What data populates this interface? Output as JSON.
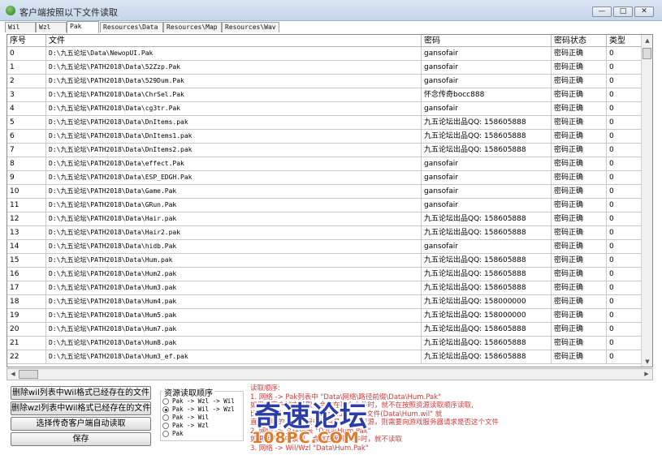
{
  "window": {
    "title": "客户端按照以下文件读取",
    "minimize_label": "—",
    "maximize_label": "□",
    "close_label": "✕",
    "icon": "app-icon"
  },
  "tabs": [
    {
      "label": "Wil"
    },
    {
      "label": "Wzl"
    },
    {
      "label": "Pak"
    },
    {
      "label": "Resources\\Data"
    },
    {
      "label": "Resources\\Map"
    },
    {
      "label": "Resources\\Wav"
    }
  ],
  "table": {
    "columns": [
      "序号",
      "文件",
      "密码",
      "密码状态",
      "类型"
    ],
    "rows": [
      [
        "0",
        "D:\\九五论坛\\Data\\NewopUI.Pak",
        "gansofair",
        "密码正确",
        "0"
      ],
      [
        "1",
        "D:\\九五论坛\\PATH2018\\Data\\52Zzp.Pak",
        "gansofair",
        "密码正确",
        "0"
      ],
      [
        "2",
        "D:\\九五论坛\\PATH2018\\Data\\529Dum.Pak",
        "gansofair",
        "密码正确",
        "0"
      ],
      [
        "3",
        "D:\\九五论坛\\PATH2018\\Data\\ChrSel.Pak",
        "怀念传奇bocc888",
        "密码正确",
        "0"
      ],
      [
        "4",
        "D:\\九五论坛\\PATH2018\\Data\\cg3tr.Pak",
        "gansofair",
        "密码正确",
        "0"
      ],
      [
        "5",
        "D:\\九五论坛\\PATH2018\\Data\\DnItems.pak",
        "九五论坛出品QQ: 158605888",
        "密码正确",
        "0"
      ],
      [
        "6",
        "D:\\九五论坛\\PATH2018\\Data\\DnItems1.pak",
        "九五论坛出品QQ: 158605888",
        "密码正确",
        "0"
      ],
      [
        "7",
        "D:\\九五论坛\\PATH2018\\Data\\DnItems2.pak",
        "九五论坛出品QQ: 158605888",
        "密码正确",
        "0"
      ],
      [
        "8",
        "D:\\九五论坛\\PATH2018\\Data\\effect.Pak",
        "gansofair",
        "密码正确",
        "0"
      ],
      [
        "9",
        "D:\\九五论坛\\PATH2018\\Data\\ESP_EDGH.Pak",
        "gansofair",
        "密码正确",
        "0"
      ],
      [
        "10",
        "D:\\九五论坛\\PATH2018\\Data\\Game.Pak",
        "gansofair",
        "密码正确",
        "0"
      ],
      [
        "11",
        "D:\\九五论坛\\PATH2018\\Data\\GRun.Pak",
        "gansofair",
        "密码正确",
        "0"
      ],
      [
        "12",
        "D:\\九五论坛\\PATH2018\\Data\\Hair.pak",
        "九五论坛出品QQ: 158605888",
        "密码正确",
        "0"
      ],
      [
        "13",
        "D:\\九五论坛\\PATH2018\\Data\\Hair2.pak",
        "九五论坛出品QQ: 158605888",
        "密码正确",
        "0"
      ],
      [
        "14",
        "D:\\九五论坛\\PATH2018\\Data\\hidb.Pak",
        "gansofair",
        "密码正确",
        "0"
      ],
      [
        "15",
        "D:\\九五论坛\\PATH2018\\Data\\Hum.pak",
        "九五论坛出品QQ: 158605888",
        "密码正确",
        "0"
      ],
      [
        "16",
        "D:\\九五论坛\\PATH2018\\Data\\Hum2.pak",
        "九五论坛出品QQ: 158605888",
        "密码正确",
        "0"
      ],
      [
        "17",
        "D:\\九五论坛\\PATH2018\\Data\\Hum3.pak",
        "九五论坛出品QQ: 158605888",
        "密码正确",
        "0"
      ],
      [
        "18",
        "D:\\九五论坛\\PATH2018\\Data\\Hum4.pak",
        "九五论坛出品QQ: 158000000",
        "密码正确",
        "0"
      ],
      [
        "19",
        "D:\\九五论坛\\PATH2018\\Data\\Hum5.pak",
        "九五论坛出品QQ: 158000000",
        "密码正确",
        "0"
      ],
      [
        "20",
        "D:\\九五论坛\\PATH2018\\Data\\Hum7.pak",
        "九五论坛出品QQ: 158605888",
        "密码正确",
        "0"
      ],
      [
        "21",
        "D:\\九五论坛\\PATH2018\\Data\\Hum8.pak",
        "九五论坛出品QQ: 158605888",
        "密码正确",
        "0"
      ],
      [
        "22",
        "D:\\九五论坛\\PATH2018\\Data\\Hum3_ef.pak",
        "九五论坛出品QQ: 158605888",
        "密码正确",
        "0"
      ]
    ]
  },
  "buttons": {
    "delete_wil_tree": "删除wil列表中Wil格式已经存在的文件",
    "delete_wzl_tree": "删除wzl列表中Wil格式已经存在的文件",
    "select_client": "选择传奇客户端自动读取",
    "save": "保存"
  },
  "load_order": {
    "title": "资源读取顺序",
    "options": [
      {
        "label": "Pak -> Wzl -> Wil",
        "selected": false
      },
      {
        "label": "Pak -> Wil -> Wzl",
        "selected": true
      },
      {
        "label": "Pak -> Wil",
        "selected": false
      },
      {
        "label": "Pak -> Wzl",
        "selected": false
      },
      {
        "label": "Pak",
        "selected": false
      }
    ]
  },
  "notes": [
    "读取顺序:",
    "1.  网络 -> Pak列表中 \"Data\\网络\\路径前缀\\Data\\Hum.Pak\"",
    "    如果在客户端中读取，会存在某个文件时，就不在按照资源读取顺序读取,",
    "    比如Wil列表中存在 \"Data\\Hum.wil\" 文件(Data\\Hum.wil\" 就",
    "    直接读取的。如果服务器目录中有此资源，则需要向游戏服务器请求是否这个文件",
    "2.  网络 -> 文件列表 \"Data\\Hum.Pak\"",
    "    如果客户端中读取，会存在某个文件时，就不读取",
    "3.  网络 -> Wil/Wzl \"Data\\Hum.Pak\""
  ],
  "watermark": {
    "brand": "奇速论坛",
    "url": "108PC.COM"
  },
  "colors": {
    "notes": "#d23b3b",
    "watermark_brand": "#2b3ea8",
    "watermark_url": "#e07b2b"
  }
}
